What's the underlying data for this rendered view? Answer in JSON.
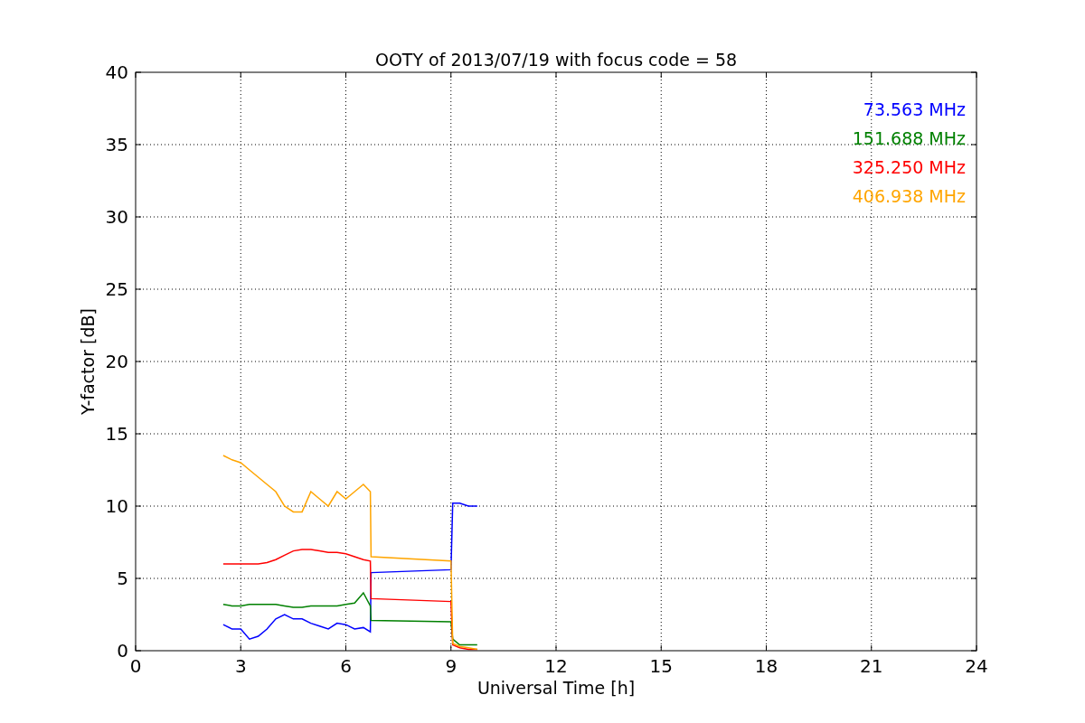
{
  "figure": {
    "chart_data": {
      "type": "line",
      "title": "OOTY of 2013/07/19 with focus code = 58",
      "xlabel": "Universal Time [h]",
      "ylabel": "Y-factor [dB]",
      "x": [
        2.5,
        2.75,
        3,
        3.25,
        3.5,
        3.75,
        4,
        4.25,
        4.5,
        4.75,
        5,
        5.25,
        5.5,
        5.75,
        6,
        6.25,
        6.5,
        6.7,
        6.72,
        9.0,
        9.05,
        9.25,
        9.5,
        9.75
      ],
      "series": [
        {
          "name": "73.563 MHz",
          "color": "#0000ff",
          "values": [
            1.8,
            1.5,
            1.5,
            0.8,
            1.0,
            1.5,
            2.2,
            2.5,
            2.2,
            2.2,
            1.9,
            1.7,
            1.5,
            1.9,
            1.8,
            1.5,
            1.6,
            1.3,
            5.4,
            5.6,
            10.2,
            10.2,
            10,
            10
          ]
        },
        {
          "name": "151.688 MHz",
          "color": "#008000",
          "values": [
            3.2,
            3.1,
            3.1,
            3.2,
            3.2,
            3.2,
            3.2,
            3.1,
            3.0,
            3.0,
            3.1,
            3.1,
            3.1,
            3.1,
            3.2,
            3.3,
            4.0,
            3.1,
            2.1,
            2.0,
            0.8,
            0.4,
            0.4,
            0.4
          ]
        },
        {
          "name": "325.250 MHz",
          "color": "#ff0000",
          "values": [
            6.0,
            6.0,
            6.0,
            6.0,
            6.0,
            6.1,
            6.3,
            6.6,
            6.9,
            7.0,
            7.0,
            6.9,
            6.8,
            6.8,
            6.7,
            6.5,
            6.3,
            6.2,
            3.6,
            3.4,
            0.4,
            0.2,
            0.1,
            0.1
          ]
        },
        {
          "name": "406.938 MHz",
          "color": "#ffa500",
          "values": [
            13.5,
            13.2,
            13.0,
            12.5,
            12.0,
            11.5,
            11.0,
            10.0,
            9.6,
            9.6,
            11.0,
            10.5,
            10.0,
            11.0,
            10.5,
            11.0,
            11.5,
            11.0,
            6.5,
            6.2,
            0.5,
            0.3,
            0.2,
            0.1
          ]
        }
      ],
      "xlim": [
        0,
        24
      ],
      "ylim": [
        0,
        40
      ],
      "xticks": [
        0,
        3,
        6,
        9,
        12,
        15,
        18,
        21,
        24
      ],
      "yticks": [
        0,
        5,
        10,
        15,
        20,
        25,
        30,
        35,
        40
      ],
      "grid": true
    }
  }
}
